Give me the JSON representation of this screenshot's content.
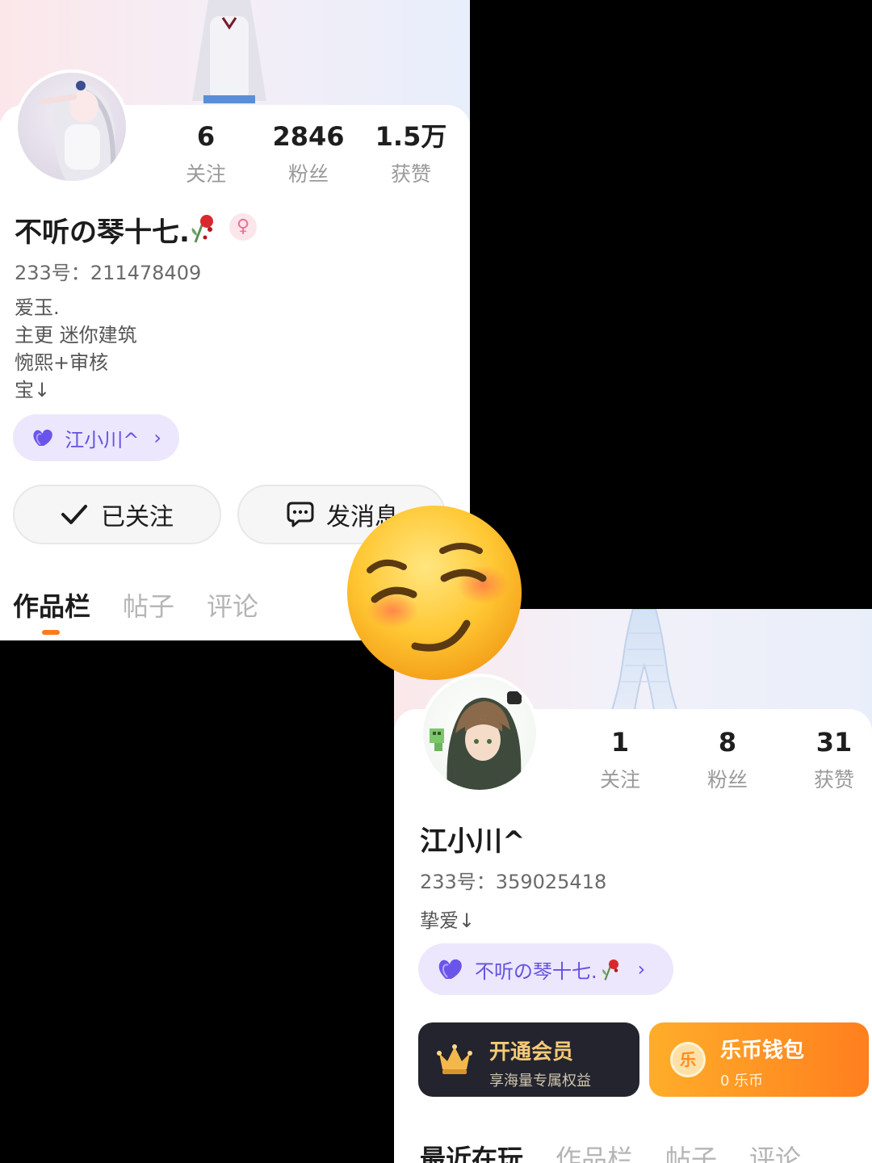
{
  "profile_a": {
    "stats": [
      {
        "value": "6",
        "label": "关注"
      },
      {
        "value": "2846",
        "label": "粉丝"
      },
      {
        "value": "1.5万",
        "label": "获赞"
      }
    ],
    "nickname": "不听の琴十七.",
    "gender_icon": "female-symbol",
    "uid": "233号：211478409",
    "bio": [
      "爱玉.",
      "主更 迷你建筑",
      "惋熙+审核",
      "宝↓"
    ],
    "cp_name": "江小川^",
    "follow_label": "已关注",
    "message_label": "发消息",
    "tabs": [
      "作品栏",
      "帖子",
      "评论"
    ],
    "active_tab": "作品栏"
  },
  "profile_b": {
    "stats": [
      {
        "value": "1",
        "label": "关注"
      },
      {
        "value": "8",
        "label": "粉丝"
      },
      {
        "value": "31",
        "label": "获赞"
      }
    ],
    "nickname": "江小川^",
    "uid": "233号：359025418",
    "bio": "挚爱↓",
    "cp_name": "不听の琴十七.",
    "vip": {
      "title": "开通会员",
      "subtitle": "享海量专属权益"
    },
    "wallet": {
      "title": "乐币钱包",
      "subtitle": "0 乐币",
      "coin_glyph": "乐"
    },
    "tabs": [
      "最近在玩",
      "作品栏",
      "帖子",
      "评论"
    ],
    "active_tab": "最近在玩"
  },
  "colors": {
    "accent_orange": "#ff7a1c",
    "cp_purple": "#6452e0",
    "vip_dark": "#23242d",
    "vip_gold": "#f5c977"
  },
  "icons": {
    "heart": "purple-double-heart-icon",
    "flower": "wilted-rose-icon",
    "check": "check-icon",
    "chat": "chat-bubble-icon",
    "crown": "crown-icon",
    "coin": "coin-icon",
    "sticker": "smiling-blush-emoji"
  }
}
